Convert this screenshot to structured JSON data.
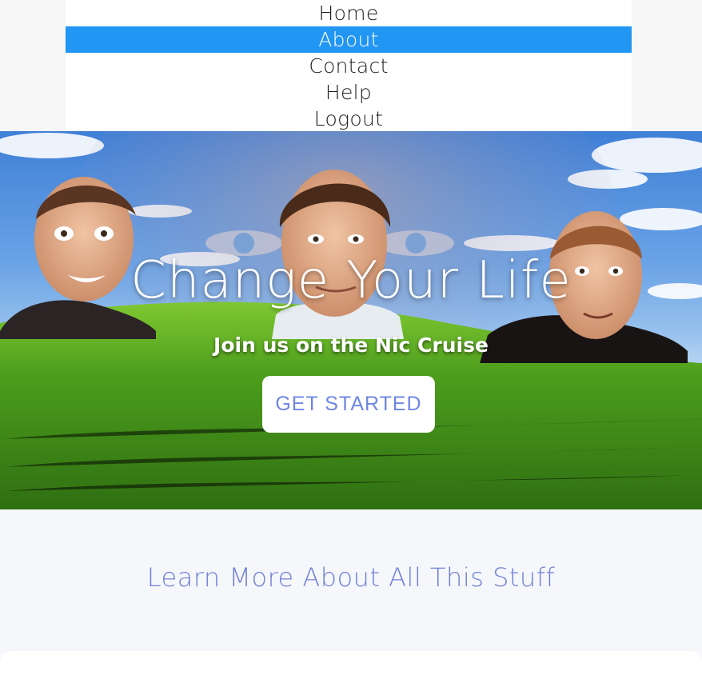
{
  "nav": {
    "items": [
      {
        "label": "Home",
        "active": false
      },
      {
        "label": "About",
        "active": true
      },
      {
        "label": "Contact",
        "active": false
      },
      {
        "label": "Help",
        "active": false
      },
      {
        "label": "Logout",
        "active": false
      }
    ]
  },
  "hero": {
    "title": "Change Your Life",
    "subtitle": "Join us on the Nic Cruise",
    "cta_label": "GET STARTED"
  },
  "section": {
    "heading": "Learn More About All This Stuff"
  },
  "colors": {
    "nav_active": "#2196f3",
    "cta_text": "#6f86e3",
    "section_heading": "#7080d6"
  }
}
